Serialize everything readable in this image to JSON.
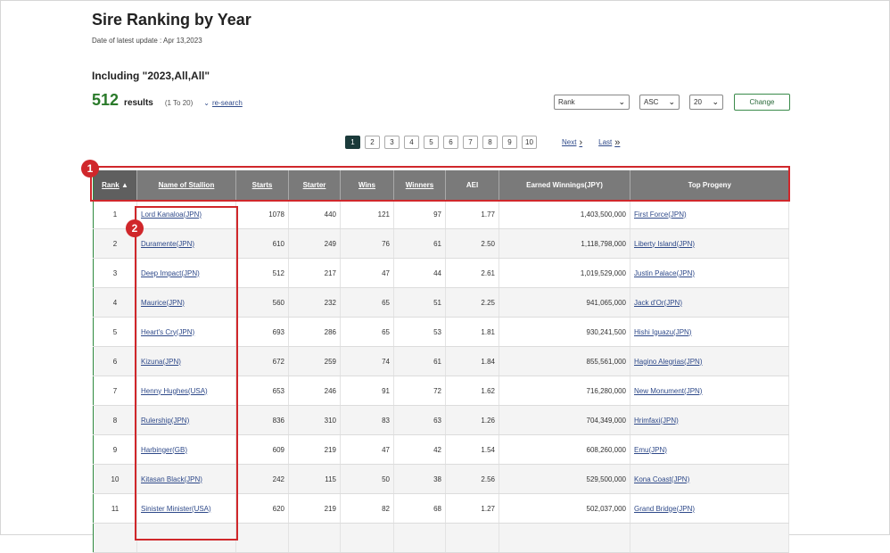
{
  "header": {
    "title": "Sire Ranking by Year",
    "updated": "Date of latest update : Apr 13,2023",
    "criteria": "Including \"2023,All,All\""
  },
  "results": {
    "count": "512",
    "label": "results",
    "range": "(1 To 20)",
    "research_caret": "⌄",
    "research_label": "re-search"
  },
  "controls": {
    "sort_by": "Rank",
    "order": "ASC",
    "per_page": "20",
    "change_label": "Change"
  },
  "pagination": {
    "pages": [
      "1",
      "2",
      "3",
      "4",
      "5",
      "6",
      "7",
      "8",
      "9",
      "10"
    ],
    "active": "1",
    "next_label": "Next",
    "last_label": "Last"
  },
  "table": {
    "columns": {
      "rank": "Rank",
      "sort_indicator": "▲",
      "name": "Name of Stallion",
      "starts": "Starts",
      "starter": "Starter",
      "wins": "Wins",
      "winners": "Winners",
      "aei": "AEI",
      "earned": "Earned Winnings(JPY)",
      "progeny": "Top Progeny"
    },
    "rows": [
      {
        "rank": "1",
        "name": "Lord Kanaloa(JPN)",
        "starts": "1078",
        "starter": "440",
        "wins": "121",
        "winners": "97",
        "aei": "1.77",
        "earned": "1,403,500,000",
        "progeny": "First Force(JPN)"
      },
      {
        "rank": "2",
        "name": "Duramente(JPN)",
        "starts": "610",
        "starter": "249",
        "wins": "76",
        "winners": "61",
        "aei": "2.50",
        "earned": "1,118,798,000",
        "progeny": "Liberty Island(JPN)"
      },
      {
        "rank": "3",
        "name": "Deep Impact(JPN)",
        "starts": "512",
        "starter": "217",
        "wins": "47",
        "winners": "44",
        "aei": "2.61",
        "earned": "1,019,529,000",
        "progeny": "Justin Palace(JPN)"
      },
      {
        "rank": "4",
        "name": "Maurice(JPN)",
        "starts": "560",
        "starter": "232",
        "wins": "65",
        "winners": "51",
        "aei": "2.25",
        "earned": "941,065,000",
        "progeny": "Jack d'Or(JPN)"
      },
      {
        "rank": "5",
        "name": "Heart's Cry(JPN)",
        "starts": "693",
        "starter": "286",
        "wins": "65",
        "winners": "53",
        "aei": "1.81",
        "earned": "930,241,500",
        "progeny": "Hishi Iguazu(JPN)"
      },
      {
        "rank": "6",
        "name": "Kizuna(JPN)",
        "starts": "672",
        "starter": "259",
        "wins": "74",
        "winners": "61",
        "aei": "1.84",
        "earned": "855,561,000",
        "progeny": "Hagino Alegrias(JPN)"
      },
      {
        "rank": "7",
        "name": "Henny Hughes(USA)",
        "starts": "653",
        "starter": "246",
        "wins": "91",
        "winners": "72",
        "aei": "1.62",
        "earned": "716,280,000",
        "progeny": "New Monument(JPN)"
      },
      {
        "rank": "8",
        "name": "Rulership(JPN)",
        "starts": "836",
        "starter": "310",
        "wins": "83",
        "winners": "63",
        "aei": "1.26",
        "earned": "704,349,000",
        "progeny": "Hrimfaxi(JPN)"
      },
      {
        "rank": "9",
        "name": "Harbinger(GB)",
        "starts": "609",
        "starter": "219",
        "wins": "47",
        "winners": "42",
        "aei": "1.54",
        "earned": "608,260,000",
        "progeny": "Emu(JPN)"
      },
      {
        "rank": "10",
        "name": "Kitasan Black(JPN)",
        "starts": "242",
        "starter": "115",
        "wins": "50",
        "winners": "38",
        "aei": "2.56",
        "earned": "529,500,000",
        "progeny": "Kona Coast(JPN)"
      },
      {
        "rank": "11",
        "name": "Sinister Minister(USA)",
        "starts": "620",
        "starter": "219",
        "wins": "82",
        "winners": "68",
        "aei": "1.27",
        "earned": "502,037,000",
        "progeny": "Grand Bridge(JPN)"
      },
      {
        "rank": "",
        "name": "",
        "starts": "",
        "starter": "",
        "wins": "",
        "winners": "",
        "aei": "",
        "earned": "",
        "progeny": ""
      }
    ]
  },
  "annotations": {
    "badge1": "1",
    "badge2": "2",
    "color": "#d0272b"
  },
  "colors": {
    "header_bg": "#7a7a7a",
    "count_green": "#2a7a2a",
    "link_blue": "#2f4a8a",
    "active_page": "#1b3b3b"
  }
}
